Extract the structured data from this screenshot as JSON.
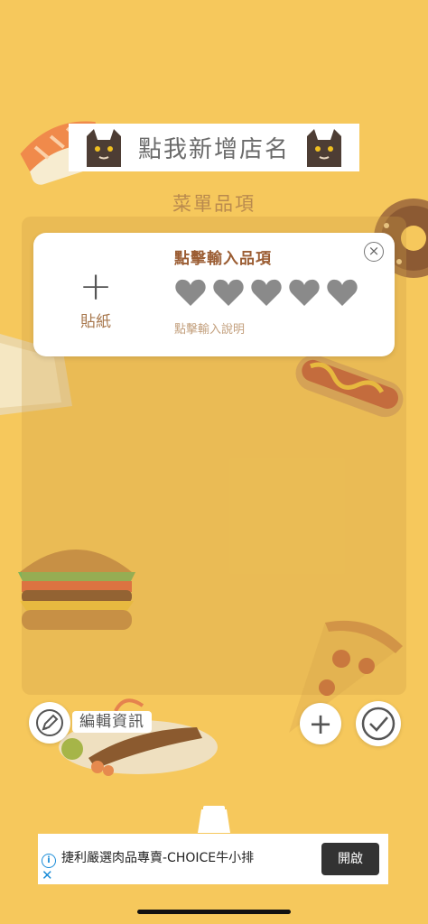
{
  "header": {
    "store_name_placeholder": "點我新增店名"
  },
  "menu": {
    "section_title": "菜單品項"
  },
  "item_card": {
    "sticker_plus": "+",
    "sticker_label": "貼紙",
    "item_name_placeholder": "點擊輸入品項",
    "rating": {
      "max": 5,
      "value": 0
    },
    "description_placeholder": "點擊輸入說明",
    "close_symbol": "×"
  },
  "toolbar": {
    "edit_info_label": "編輯資訊",
    "add_symbol": "+"
  },
  "ad": {
    "text": "捷利嚴選肉品專賣-CHOICE牛小排",
    "open_label": "開啟",
    "info_symbol": "i",
    "close_symbol": "✕"
  },
  "colors": {
    "background": "#f6c85c",
    "heart": "#8a8a8a",
    "accent_brown": "#9b5d33"
  }
}
